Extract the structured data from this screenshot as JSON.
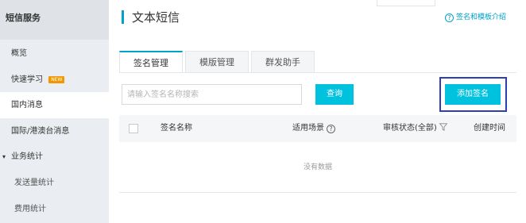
{
  "sidebar": {
    "header": "短信服务",
    "items": [
      {
        "label": "概览"
      },
      {
        "label": "快速学习",
        "badge": "NEW"
      },
      {
        "label": "国内消息"
      },
      {
        "label": "国际/港澳台消息"
      },
      {
        "label": "业务统计"
      },
      {
        "label": "发送量统计"
      },
      {
        "label": "费用统计"
      }
    ]
  },
  "header": {
    "title": "文本短信",
    "help_link": "签名和模板介绍",
    "help_icon": "?"
  },
  "tabs": [
    {
      "label": "签名管理"
    },
    {
      "label": "模版管理"
    },
    {
      "label": "群发助手"
    }
  ],
  "search": {
    "placeholder": "请输入签名名称搜索",
    "query_button": "查询",
    "add_button": "添加签名"
  },
  "table": {
    "columns": [
      "签名名称",
      "适用场景",
      "审核状态(全部)",
      "创建时间"
    ],
    "help_icon": "?",
    "empty_text": "没有数据"
  },
  "colors": {
    "accent": "#00a2ca",
    "button": "#00c1de",
    "highlight_frame": "#2e3fb3",
    "new_badge": "#f39700"
  }
}
